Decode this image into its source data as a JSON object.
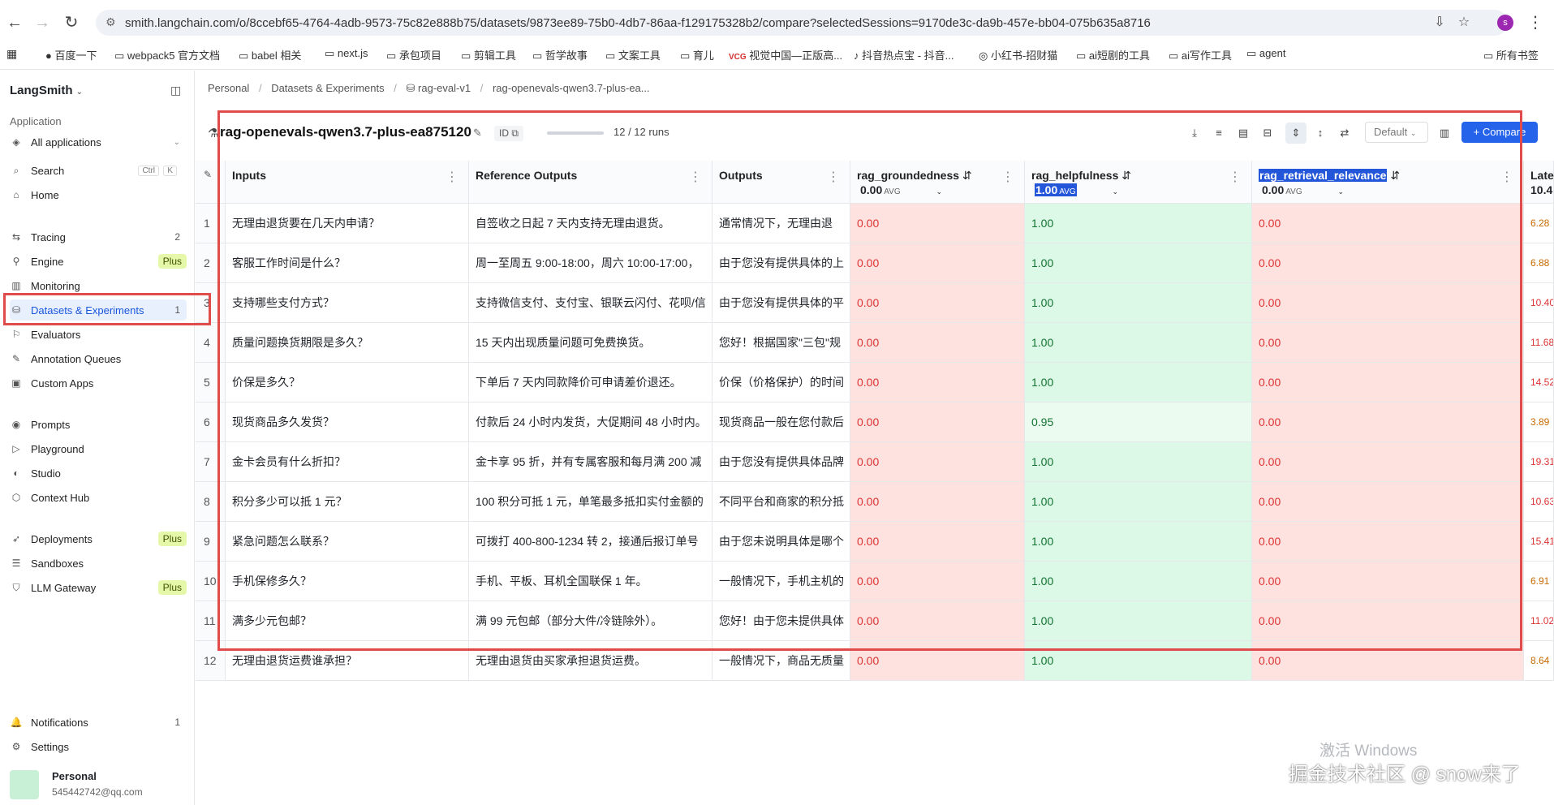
{
  "browser": {
    "url": "smith.langchain.com/o/8ccebf65-4764-4adb-9573-75c82e888b75/datasets/9873ee89-75b0-4db7-86aa-f129175328b2/compare?selectedSessions=9170de3c-da9b-457e-bb04-075b635a8716",
    "profile_initial": "s",
    "bookmarks": [
      "百度一下",
      "webpack5 官方文档",
      "babel 相关",
      "next.js",
      "承包项目",
      "剪辑工具",
      "哲学故事",
      "文案工具",
      "育儿",
      "视觉中国—正版高...",
      "抖音热点宝 - 抖音...",
      "小红书-招财猫",
      "ai短剧的工具",
      "ai写作工具",
      "agent",
      "所有书签"
    ]
  },
  "sidebar": {
    "workspace": "LangSmith",
    "section_label": "Application",
    "app_select": "All applications",
    "search": {
      "label": "Search",
      "shortcut_ctrl": "Ctrl",
      "shortcut_key": "K"
    },
    "home": "Home",
    "items": [
      {
        "label": "Tracing",
        "count": "2"
      },
      {
        "label": "Engine",
        "badge": "Plus"
      },
      {
        "label": "Monitoring"
      },
      {
        "label": "Datasets & Experiments",
        "count": "1"
      },
      {
        "label": "Evaluators"
      },
      {
        "label": "Annotation Queues"
      },
      {
        "label": "Custom Apps"
      },
      {
        "label": "Prompts"
      },
      {
        "label": "Playground"
      },
      {
        "label": "Studio"
      },
      {
        "label": "Context Hub"
      },
      {
        "label": "Deployments",
        "badge": "Plus"
      },
      {
        "label": "Sandboxes"
      },
      {
        "label": "LLM Gateway",
        "badge": "Plus"
      }
    ],
    "notifications": {
      "label": "Notifications",
      "count": "1"
    },
    "settings": "Settings",
    "user": {
      "name": "Personal",
      "email": "545442742@qq.com"
    }
  },
  "breadcrumb": [
    "Personal",
    "Datasets & Experiments",
    "rag-eval-v1",
    "rag-openevals-qwen3.7-plus-ea..."
  ],
  "toolbar": {
    "title": "rag-openevals-qwen3.7-plus-ea875120",
    "id_label": "ID",
    "runs": "12 / 12 runs",
    "view_select": "Default",
    "compare_label": "+ Compare"
  },
  "columns": {
    "inputs": "Inputs",
    "reference": "Reference Outputs",
    "outputs": "Outputs",
    "metric1": {
      "label": "rag_groundedness",
      "avg": "0.00",
      "avg_unit": "AVG"
    },
    "metric2": {
      "label": "rag_helpfulness",
      "avg": "1.00",
      "avg_unit": "AVG"
    },
    "metric3": {
      "label": "rag_retrieval_relevance",
      "avg": "0.00",
      "avg_unit": "AVG"
    },
    "latency": {
      "label": "Late",
      "avg": "10.4"
    }
  },
  "rows": [
    {
      "n": "1",
      "input": "无理由退货要在几天内申请？",
      "ref": "自签收之日起 7 天内支持无理由退货。",
      "out": "通常情况下，无理由退",
      "g": "0.00",
      "h": "1.00",
      "r": "0.00",
      "lat": "6.28"
    },
    {
      "n": "2",
      "input": "客服工作时间是什么？",
      "ref": "周一至周五 9:00-18:00，周六 10:00-17:00，",
      "out": "由于您没有提供具体的上",
      "g": "0.00",
      "h": "1.00",
      "r": "0.00",
      "lat": "6.88"
    },
    {
      "n": "3",
      "input": "支持哪些支付方式？",
      "ref": "支持微信支付、支付宝、银联云闪付、花呗/信",
      "out": "由于您没有提供具体的平",
      "g": "0.00",
      "h": "1.00",
      "r": "0.00",
      "lat": "10.40"
    },
    {
      "n": "4",
      "input": "质量问题换货期限是多久？",
      "ref": "15 天内出现质量问题可免费换货。",
      "out": "您好！根据国家\"三包\"规",
      "g": "0.00",
      "h": "1.00",
      "r": "0.00",
      "lat": "11.68"
    },
    {
      "n": "5",
      "input": "价保是多久？",
      "ref": "下单后 7 天内同款降价可申请差价退还。",
      "out": "价保（价格保护）的时间",
      "g": "0.00",
      "h": "1.00",
      "r": "0.00",
      "lat": "14.52"
    },
    {
      "n": "6",
      "input": "现货商品多久发货？",
      "ref": "付款后 24 小时内发货，大促期间 48 小时内。",
      "out": "现货商品一般在您付款后",
      "g": "0.00",
      "h": "0.95",
      "r": "0.00",
      "lat": "3.89"
    },
    {
      "n": "7",
      "input": "金卡会员有什么折扣？",
      "ref": "金卡享 95 折，并有专属客服和每月满 200 减",
      "out": "由于您没有提供具体品牌",
      "g": "0.00",
      "h": "1.00",
      "r": "0.00",
      "lat": "19.31"
    },
    {
      "n": "8",
      "input": "积分多少可以抵 1 元？",
      "ref": "100 积分可抵 1 元，单笔最多抵扣实付金额的",
      "out": "不同平台和商家的积分抵",
      "g": "0.00",
      "h": "1.00",
      "r": "0.00",
      "lat": "10.63"
    },
    {
      "n": "9",
      "input": "紧急问题怎么联系？",
      "ref": "可拨打 400-800-1234 转 2，接通后报订单号",
      "out": "由于您未说明具体是哪个",
      "g": "0.00",
      "h": "1.00",
      "r": "0.00",
      "lat": "15.41"
    },
    {
      "n": "10",
      "input": "手机保修多久？",
      "ref": "手机、平板、耳机全国联保 1 年。",
      "out": "一般情况下，手机主机的",
      "g": "0.00",
      "h": "1.00",
      "r": "0.00",
      "lat": "6.91"
    },
    {
      "n": "11",
      "input": "满多少元包邮？",
      "ref": "满 99 元包邮（部分大件/冷链除外）。",
      "out": "您好！由于您未提供具体",
      "g": "0.00",
      "h": "1.00",
      "r": "0.00",
      "lat": "11.02"
    },
    {
      "n": "12",
      "input": "无理由退货运费谁承担？",
      "ref": "无理由退货由买家承担退货运费。",
      "out": "一般情况下，商品无质量",
      "g": "0.00",
      "h": "1.00",
      "r": "0.00",
      "lat": "8.64"
    }
  ],
  "overlay": {
    "activate": "激活 Windows",
    "watermark": "掘金技术社区 @ snow来了"
  }
}
